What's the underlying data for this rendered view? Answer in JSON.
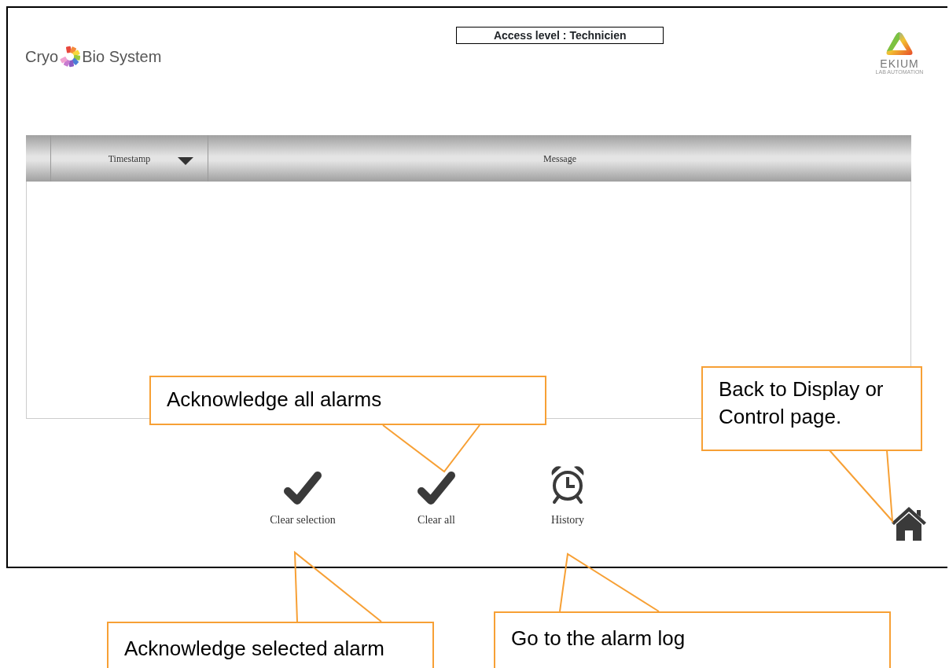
{
  "header": {
    "access_level": "Access level : Technicien",
    "brand_left": {
      "name_start": "Cryo",
      "name_end": "Bio System"
    },
    "brand_right": {
      "name": "EKIUM",
      "tagline": "LAB AUTOMATION"
    }
  },
  "table": {
    "columns": [
      {
        "label": "Timestamp",
        "sorted": true
      },
      {
        "label": "Message",
        "sorted": false
      }
    ]
  },
  "actions": [
    {
      "kind": "check",
      "label": "Clear selection"
    },
    {
      "kind": "check",
      "label": "Clear all"
    },
    {
      "kind": "clock",
      "label": "History"
    },
    {
      "kind": "home"
    }
  ],
  "callouts": [
    {
      "text": "Acknowledge all alarms"
    },
    {
      "text": "Back to Display or Control page."
    },
    {
      "text": "Acknowledge selected alarm"
    },
    {
      "text": "Go to the alarm log"
    }
  ]
}
